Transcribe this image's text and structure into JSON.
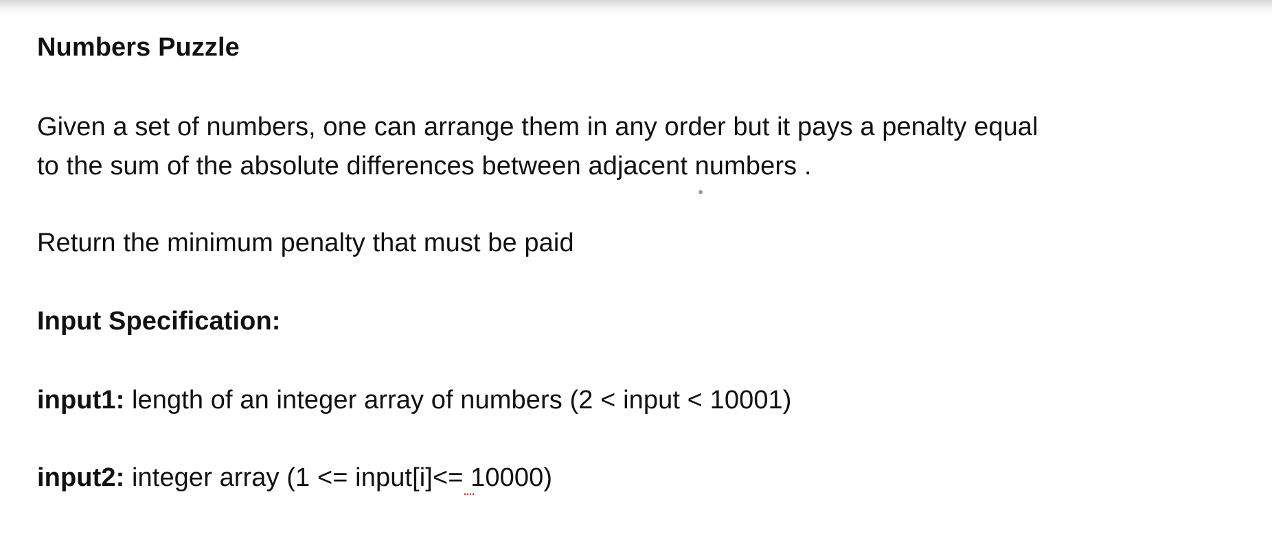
{
  "document": {
    "title": "Numbers Puzzle",
    "paragraph_line1": "Given a set of numbers, one can arrange them in any order but it pays a penalty equal",
    "paragraph_line2": "to the sum of the absolute differences between adjacent numbers .",
    "task": "Return the minimum penalty that must be paid",
    "spec_heading": "Input Specification:",
    "inputs": [
      {
        "label": "input1:",
        "description": "length of an integer array of numbers (2 < input < 10001)"
      },
      {
        "label": "input2:",
        "description": "integer array (1 <= input[i]<= 10000)"
      }
    ]
  }
}
